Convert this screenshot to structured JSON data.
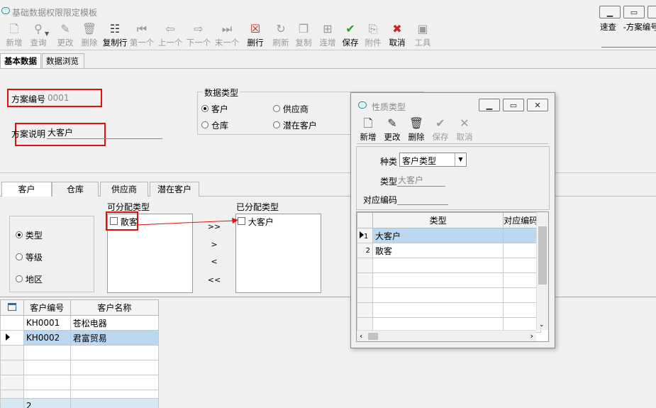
{
  "window": {
    "title": "基础数据权限限定模板",
    "speed_label": "速查",
    "speed_value": "-方案编号"
  },
  "toolbar": {
    "items": [
      {
        "label": "新增",
        "icon": "new-doc-icon",
        "enabled": false
      },
      {
        "label": "查询",
        "icon": "search-icon",
        "enabled": false
      },
      {
        "label": "更改",
        "icon": "edit-icon",
        "enabled": false
      },
      {
        "label": "删除",
        "icon": "trash-icon",
        "enabled": false
      },
      {
        "label": "复制行",
        "icon": "copy-row-icon",
        "enabled": true
      },
      {
        "label": "第一个",
        "icon": "first-icon",
        "enabled": false
      },
      {
        "label": "上一个",
        "icon": "prev-icon",
        "enabled": false
      },
      {
        "label": "下一个",
        "icon": "next-icon",
        "enabled": false
      },
      {
        "label": "末一个",
        "icon": "last-icon",
        "enabled": false
      },
      {
        "label": "删行",
        "icon": "delete-row-icon",
        "enabled": true
      },
      {
        "label": "刷新",
        "icon": "refresh-icon",
        "enabled": false
      },
      {
        "label": "复制",
        "icon": "copy-icon",
        "enabled": false
      },
      {
        "label": "连增",
        "icon": "continuous-add-icon",
        "enabled": false
      },
      {
        "label": "保存",
        "icon": "save-check-icon",
        "enabled": true
      },
      {
        "label": "附件",
        "icon": "attachment-icon",
        "enabled": false
      },
      {
        "label": "取消",
        "icon": "cancel-x-icon",
        "enabled": true
      },
      {
        "label": "工具",
        "icon": "toolbox-icon",
        "enabled": false
      }
    ]
  },
  "main_tabs": [
    "基本数据",
    "数据浏览"
  ],
  "form": {
    "scheme_no_label": "方案编号",
    "scheme_no_value": "0001",
    "scheme_desc_label": "方案说明",
    "scheme_desc_value": "大客户",
    "data_type_label": "数据类型",
    "data_type_options": [
      "客户",
      "供应商",
      "仓库",
      "潜在客户"
    ],
    "data_type_selected": "客户"
  },
  "sub_tabs": [
    "客户",
    "仓库",
    "供应商",
    "潜在客户"
  ],
  "assign": {
    "mode_options": [
      "类型",
      "等级",
      "地区"
    ],
    "mode_selected": "类型",
    "available_label": "可分配类型",
    "available_items": [
      "散客"
    ],
    "assigned_label": "已分配类型",
    "assigned_items": [
      "大客户"
    ],
    "move_buttons": [
      ">>",
      ">",
      "<",
      "<<"
    ]
  },
  "customer_grid": {
    "columns": [
      "客户编号",
      "客户名称"
    ],
    "rows": [
      [
        "KH0001",
        "苍松电器"
      ],
      [
        "KH0002",
        "君富贸易"
      ]
    ],
    "selected_row": 1,
    "footer_count": "2"
  },
  "dialog": {
    "title": "性质类型",
    "toolbar": [
      {
        "label": "新增",
        "icon": "new-doc-icon",
        "enabled": true
      },
      {
        "label": "更改",
        "icon": "pencil-icon",
        "enabled": true
      },
      {
        "label": "删除",
        "icon": "trash-icon",
        "enabled": true
      },
      {
        "label": "保存",
        "icon": "check-icon",
        "enabled": false
      },
      {
        "label": "取消",
        "icon": "x-icon",
        "enabled": false
      }
    ],
    "kind_label": "种类",
    "kind_value": "客户类型",
    "type_label": "类型",
    "type_value": "大客户",
    "code_label": "对应编码",
    "code_value": "",
    "grid_columns": [
      "类型",
      "对应编码"
    ],
    "grid_rows": [
      {
        "no": "1",
        "type": "大客户"
      },
      {
        "no": "2",
        "type": "散客"
      }
    ],
    "selected_row": 0
  },
  "colors": {
    "highlight_red": "#e01010",
    "selection_blue": "#bcd8f0",
    "disabled_text": "#9a9a9a"
  }
}
